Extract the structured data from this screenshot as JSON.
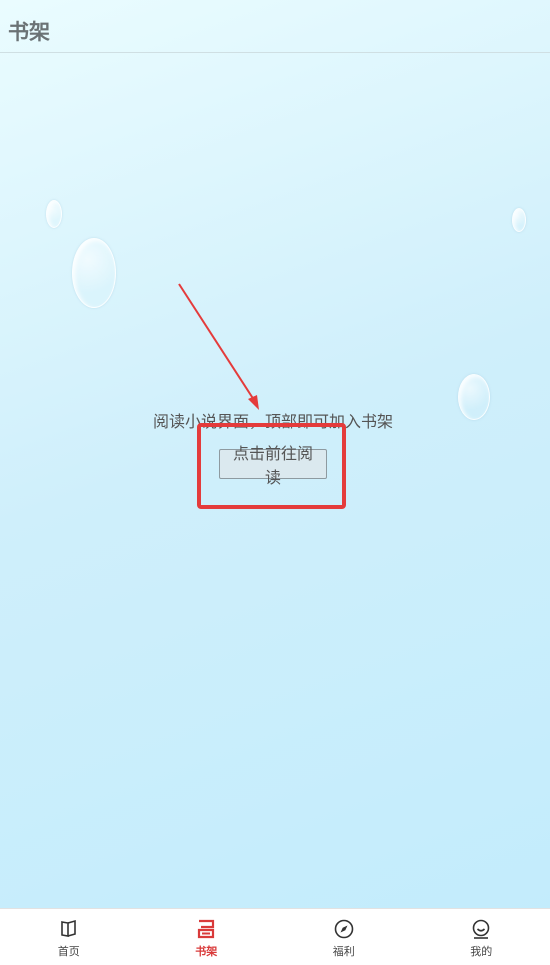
{
  "header": {
    "title": "书架"
  },
  "shelf": {
    "empty_message": "阅读小说界面，顶部即可加入书架",
    "go_read_label": "点击前往阅读"
  },
  "tabbar": {
    "active": "书架",
    "items": [
      {
        "label": "首页",
        "icon": "book-open-icon"
      },
      {
        "label": "书架",
        "icon": "bookshelf-icon"
      },
      {
        "label": "福利",
        "icon": "compass-icon"
      },
      {
        "label": "我的",
        "icon": "smiley-user-icon"
      }
    ]
  },
  "colors": {
    "accent": "#d93a3a",
    "annotation": "#e43b3b"
  }
}
